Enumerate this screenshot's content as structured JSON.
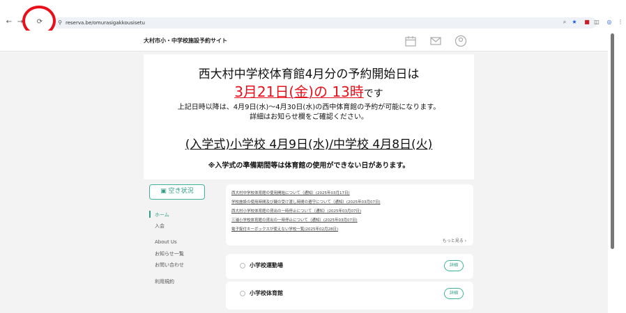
{
  "browser": {
    "url": "reserva.be/omurasigakkousisetu",
    "back_icon": "arrow-left-icon",
    "forward_icon": "arrow-right-icon",
    "reload_icon": "reload-icon"
  },
  "site": {
    "title": "大村市小・中学校施設予約サイト"
  },
  "notice": {
    "line1": "西大村中学校体育館4月分の予約開始日は",
    "line2_red": "3月21日(金)の 13時",
    "line2_suffix": "です",
    "line3": "上記日時以降は、4月9日(水)～4月30日(水)の西中体育館の予約が可能になります。",
    "line4": "詳細はお知らせ欄をご確認ください。",
    "line5": "(入学式)小学校 4月9日(水)/中学校 4月8日(火)",
    "line6": "※入学式の準備期間等は体育館の使用ができない日があります。"
  },
  "sidebar": {
    "availability_button": "空き状況",
    "links": [
      "ホーム",
      "入会",
      "About Us",
      "お知らせ一覧",
      "お問い合わせ",
      "利用規約"
    ]
  },
  "news": {
    "items": [
      "西大村中学校体育館の使用開始について（通知）(2025年03月17日)",
      "学校施設の使用時間及び鍵の受け渡し時間の遵守について（通知）(2025年03月07日)",
      "西大村小学校体育館の貸出の一時停止について（通知）(2025年03月07日)",
      "三浦小学校体育館の貸出の一時停止について（通知）(2025年03月07日)",
      "電子錠付キーボックスが使えない学校一覧(2025年02月28日)"
    ],
    "more": "もっと見る ›"
  },
  "facilities": [
    {
      "name": "小学校運動場",
      "button": "詳細"
    },
    {
      "name": "小学校体育館",
      "button": "詳細"
    }
  ]
}
